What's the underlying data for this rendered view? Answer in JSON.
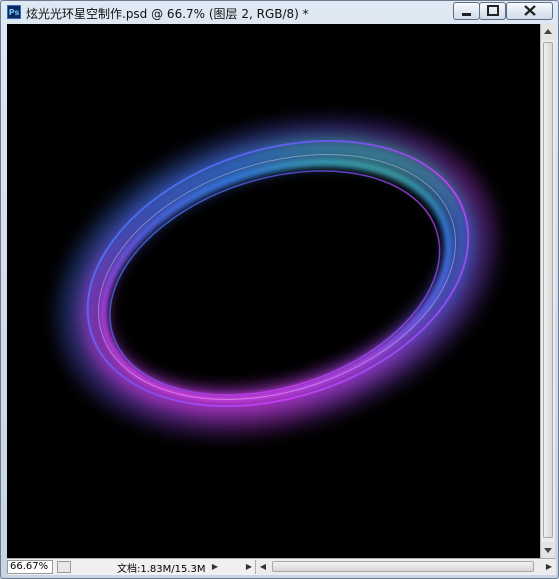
{
  "window": {
    "app_icon_label": "Ps",
    "title": "炫光光环星空制作.psd @ 66.7% (图层 2, RGB/8) *"
  },
  "status": {
    "zoom": "66.67%",
    "doc_info": "文档:1.83M/15.3M"
  },
  "icons": {
    "minimize": "minimize-icon",
    "maximize": "maximize-icon",
    "close": "close-icon"
  },
  "colors": {
    "canvas_bg": "#000000",
    "ring_green": "#4dff6a",
    "ring_blue": "#3a8fff",
    "ring_purple": "#b44cff",
    "ring_magenta": "#ff3df2"
  }
}
